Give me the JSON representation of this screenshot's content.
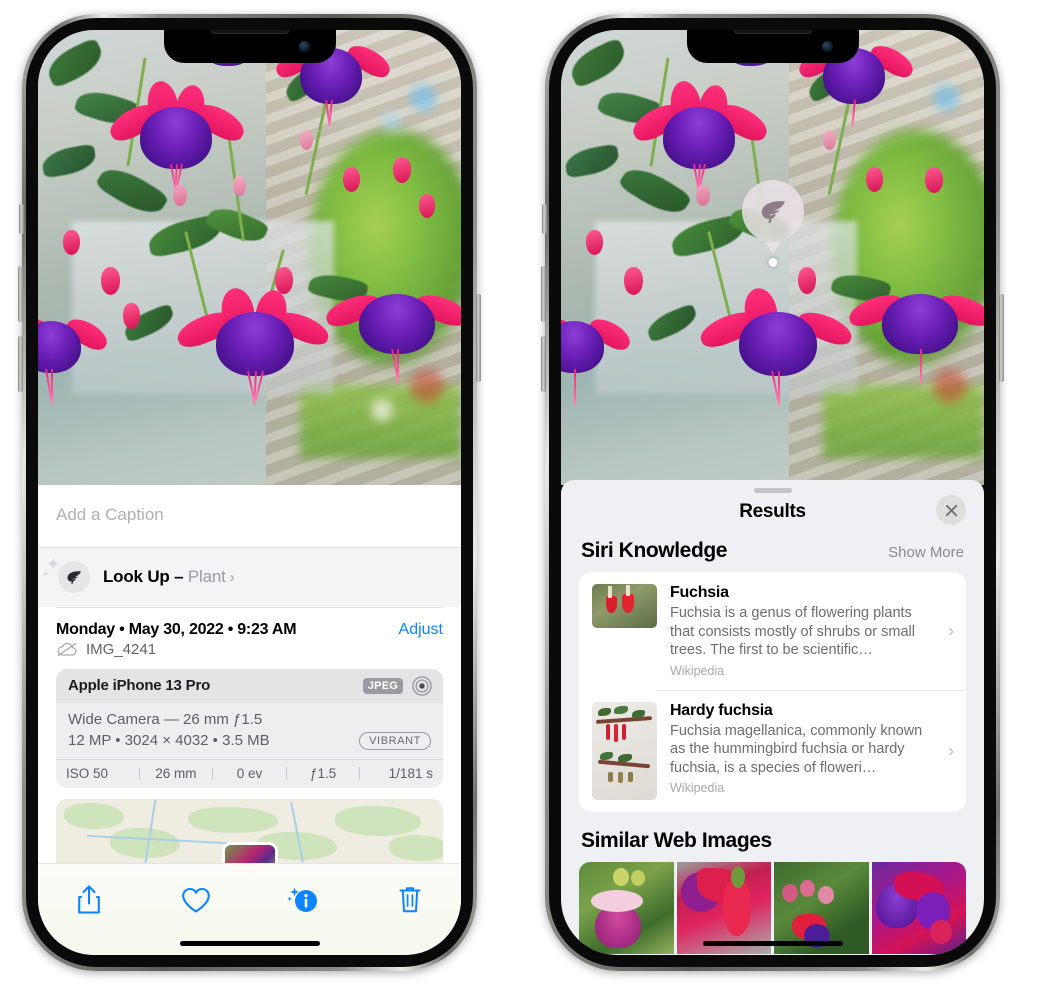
{
  "left_phone": {
    "caption_placeholder": "Add a Caption",
    "lookup": {
      "label": "Look Up – ",
      "subject": "Plant",
      "chevron": "›",
      "icon": "leaf-icon"
    },
    "date_line": "Monday • May 30, 2022 • 9:23 AM",
    "adjust_label": "Adjust",
    "filename": "IMG_4241",
    "exif": {
      "device": "Apple iPhone 13 Pro",
      "format_tag": "JPEG",
      "lens_line": "Wide Camera — 26 mm ƒ1.5",
      "size_line": "12 MP • 3024 × 4032 • 3.5 MB",
      "style_tag": "VIBRANT",
      "stats": [
        "ISO 50",
        "26 mm",
        "0 ev",
        "ƒ1.5",
        "1/181 s"
      ]
    },
    "toolbar": {
      "share_label": "share-icon",
      "favorite_label": "heart-icon",
      "info_label": "info-sparkle-icon",
      "delete_label": "trash-icon"
    }
  },
  "right_phone": {
    "badge": {
      "icon": "leaf-icon"
    },
    "sheet": {
      "title": "Results",
      "close_label": "✕"
    },
    "siri_knowledge": {
      "section_title": "Siri Knowledge",
      "show_more": "Show More",
      "items": [
        {
          "name": "Fuchsia",
          "description": "Fuchsia is a genus of flowering plants that consists mostly of shrubs or small trees. The first to be scientific…",
          "source": "Wikipedia",
          "chevron": "›"
        },
        {
          "name": "Hardy fuchsia",
          "description": "Fuchsia magellanica, commonly known as the hummingbird fuchsia or hardy fuchsia, is a species of floweri…",
          "source": "Wikipedia",
          "chevron": "›"
        }
      ]
    },
    "similar_web_images": {
      "section_title": "Similar Web Images",
      "thumbnails": [
        "fuchsia-pink-white",
        "fuchsia-red-closeup",
        "fuchsia-bush",
        "fuchsia-purple-red"
      ]
    }
  },
  "colors": {
    "accent_blue": "#0a84ff",
    "sheet_bg": "#eff0f4",
    "card_bg": "#ffffff",
    "exif_bg": "#eeeef0"
  }
}
